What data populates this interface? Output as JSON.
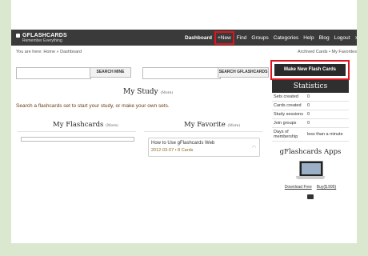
{
  "header": {
    "logo": {
      "brand": "GFLASHCARDS",
      "tagline": "Remember Everything"
    },
    "nav": [
      {
        "label": "Dashboard"
      },
      {
        "label": "+New"
      },
      {
        "label": "Find"
      },
      {
        "label": "Groups"
      },
      {
        "label": "Categories"
      },
      {
        "label": "Help"
      },
      {
        "label": "Blog"
      },
      {
        "label": "Logout"
      }
    ]
  },
  "breadcrumb": "You are here: Home » Dashboard",
  "top_links": "Archived Cards • My Favorites",
  "search": {
    "mine_button": "SEARCH MINE",
    "gflashcards_button": "SEARCH GFLASHCARDS",
    "mine_value": "",
    "gflashcards_value": ""
  },
  "make_button": "Make New Flash Cards",
  "main": {
    "my_study_title": "My Study",
    "more_label": "(More)",
    "my_study_subtitle": "Search a flashcards set to start your study, or make your own sets.",
    "my_flashcards_title": "My Flashcards",
    "my_favorite_title": "My Favorite",
    "favorite": {
      "title": "How to Use gFlashcards Web",
      "meta": "2012-03-07 • 8 Cards"
    }
  },
  "stats": {
    "title": "Statistics",
    "rows": [
      {
        "label": "Sets created",
        "value": "0"
      },
      {
        "label": "Cards created",
        "value": "0"
      },
      {
        "label": "Study sessions",
        "value": "0"
      },
      {
        "label": "Join groups",
        "value": "0"
      },
      {
        "label": "Days of membership",
        "value": "less than a minute"
      }
    ]
  },
  "apps": {
    "title": "gFlashcards Apps",
    "download_free": "Download Free",
    "buy": "Buy($.995)"
  },
  "colors": {
    "highlight": "#e0141c",
    "topbar": "#3a3a3a",
    "background": "#d9e8cf"
  }
}
